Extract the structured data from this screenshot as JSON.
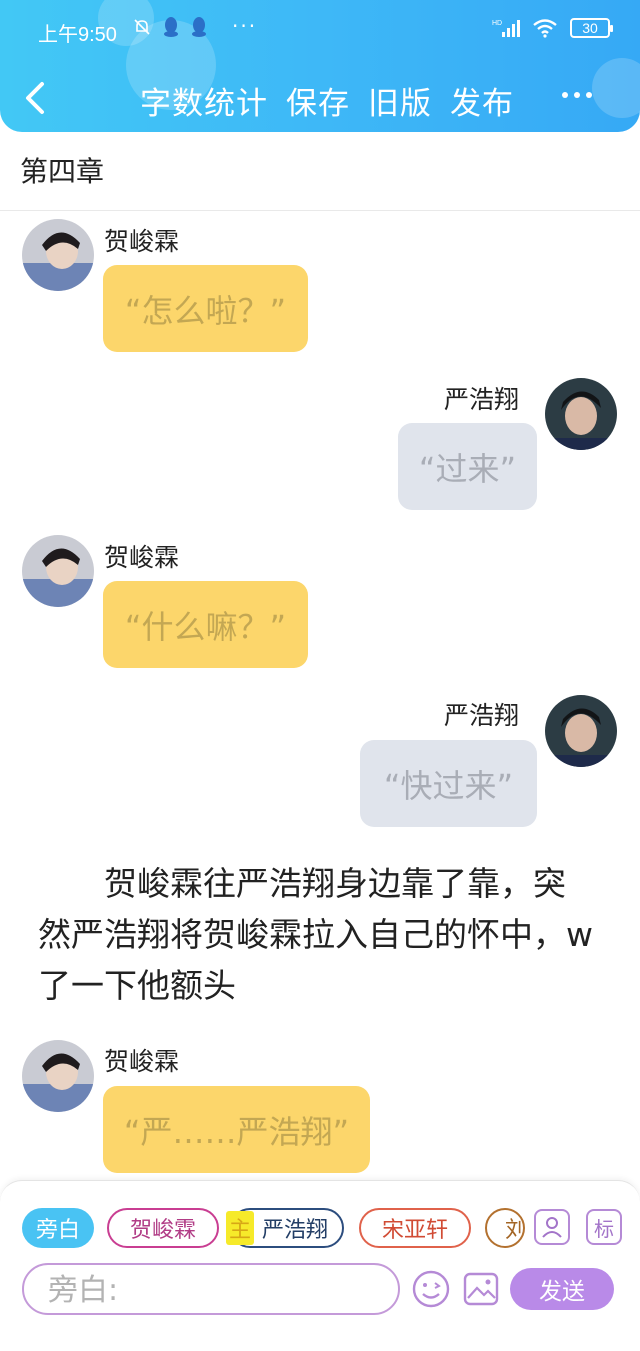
{
  "status_bar": {
    "time": "上午9:50",
    "dots": "···",
    "battery": "30",
    "network_label": "HD"
  },
  "header": {
    "nav": [
      "字数统计",
      "保存",
      "旧版",
      "发布"
    ],
    "back_icon": "chevron-left-icon",
    "more_icon": "more-dots-icon",
    "gradient_colors": [
      "#42c8f5",
      "#36a9f5"
    ]
  },
  "chapter_title": "第四章",
  "messages": [
    {
      "side": "left",
      "name": "贺峻霖",
      "text": "“怎么啦？”",
      "color": "#fcd66b"
    },
    {
      "side": "right",
      "name": "严浩翔",
      "text": "“过来”",
      "color": "#e0e4ec"
    },
    {
      "side": "left",
      "name": "贺峻霖",
      "text": "“什么嘛？”",
      "color": "#fcd66b"
    },
    {
      "side": "right",
      "name": "严浩翔",
      "text": "“快过来”",
      "color": "#e0e4ec"
    },
    {
      "side": "left",
      "name": "贺峻霖",
      "text": "“严……严浩翔”",
      "color": "#fcd66b"
    }
  ],
  "narration": "贺峻霖往严浩翔身边靠了靠，突然严浩翔将贺峻霖拉入自己的怀中，w了一下他额头",
  "roles": {
    "narrator": "旁白",
    "he": "贺峻霖",
    "main_tag": "主",
    "yan": "严浩翔",
    "song": "宋亚轩",
    "liu_partial": "刘"
  },
  "side_icons": {
    "person": "person-card-icon",
    "tag": "标"
  },
  "input": {
    "placeholder": "旁白:",
    "value": ""
  },
  "send_label": "发送",
  "accent_color": "#b98ae8"
}
